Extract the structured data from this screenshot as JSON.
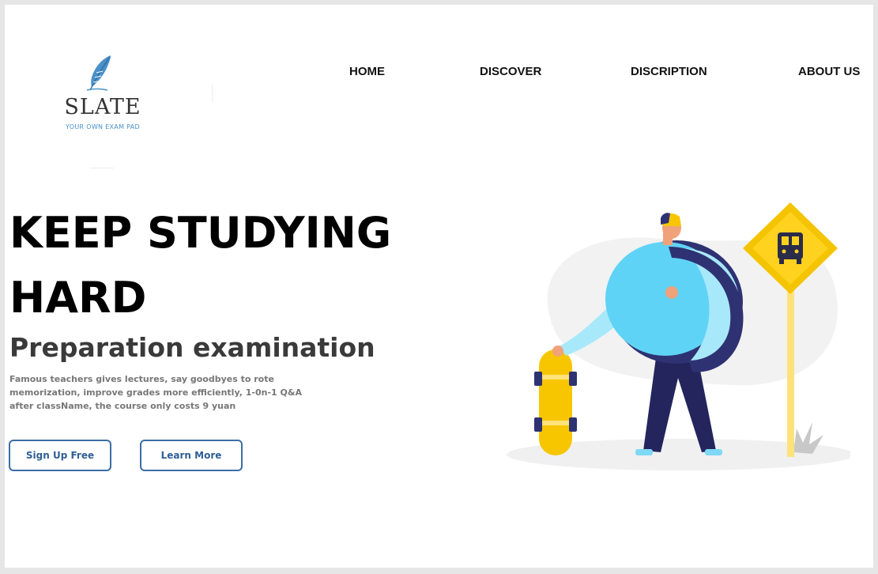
{
  "logo": {
    "name": "SLATE",
    "tagline": "YOUR OWN EXAM PAD",
    "icon": "feather-icon",
    "color": "#4a90c8"
  },
  "nav": {
    "items": [
      {
        "label": "HOME"
      },
      {
        "label": "DISCOVER"
      },
      {
        "label": "DISCRIPTION"
      },
      {
        "label": "ABOUT US"
      }
    ]
  },
  "hero": {
    "title_line1": "KEEP STUDYING",
    "title_line2": "HARD",
    "subtitle": "Preparation examination",
    "description": "Famous teachers gives lectures, say goodbyes to rote memorization, improve grades more efficiently, 1-0n-1 Q&A after className, the course only costs 9 yuan",
    "buttons": {
      "signup": "Sign Up Free",
      "learn": "Learn More"
    }
  },
  "illustration": {
    "subject": "student-with-backpack-and-skateboard",
    "sign_icon": "bus-icon",
    "colors": {
      "backpack": "#5fd3f5",
      "strap": "#2e3272",
      "skateboard": "#f7c600",
      "sign": "#f5c400",
      "pole": "#ffe27a"
    }
  },
  "colors": {
    "button_border": "#3b6ea5",
    "button_text": "#2f5f94",
    "title": "#000000",
    "subtitle": "#3a3a3a",
    "description": "#777777"
  }
}
